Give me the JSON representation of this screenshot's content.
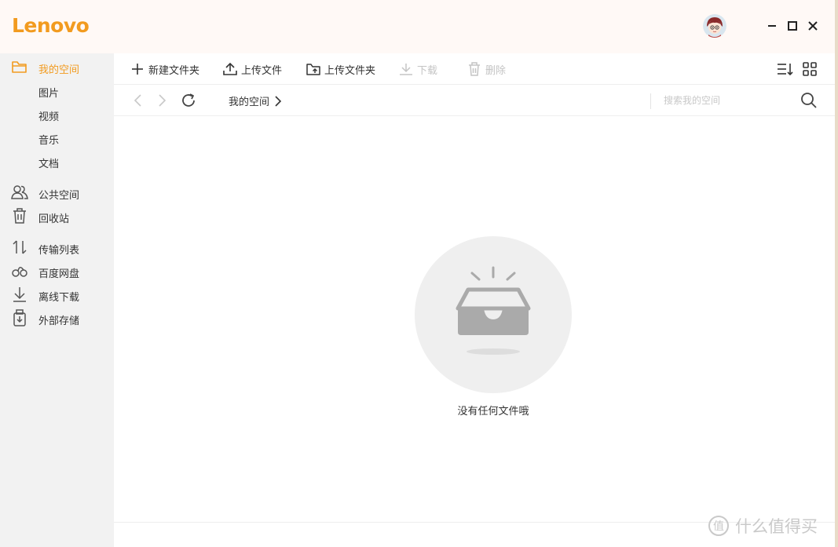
{
  "app": {
    "logo_text": "Lenovo",
    "brand_color": "#f29b1f"
  },
  "window_controls": {
    "minimize": "minimize-icon",
    "maximize": "maximize-icon",
    "close": "close-icon"
  },
  "sidebar": {
    "items": [
      {
        "label": "我的空间",
        "icon": "folder-open-icon",
        "active": true
      },
      {
        "label": "图片",
        "icon": ""
      },
      {
        "label": "视频",
        "icon": ""
      },
      {
        "label": "音乐",
        "icon": ""
      },
      {
        "label": "文档",
        "icon": ""
      },
      {
        "label": "公共空间",
        "icon": "users-icon"
      },
      {
        "label": "回收站",
        "icon": "trash-icon"
      },
      {
        "label": "传输列表",
        "icon": "transfer-icon"
      },
      {
        "label": "百度网盘",
        "icon": "baidu-cloud-icon"
      },
      {
        "label": "离线下载",
        "icon": "offline-download-icon"
      },
      {
        "label": "外部存储",
        "icon": "external-storage-icon"
      }
    ]
  },
  "toolbar": {
    "new_folder": "新建文件夹",
    "upload_file": "上传文件",
    "upload_folder": "上传文件夹",
    "download": "下载",
    "delete": "删除"
  },
  "navbar": {
    "breadcrumb": "我的空间",
    "search_placeholder": "搜索我的空间"
  },
  "empty_state": {
    "message": "没有任何文件哦"
  },
  "watermark": {
    "text": "什么值得买"
  }
}
